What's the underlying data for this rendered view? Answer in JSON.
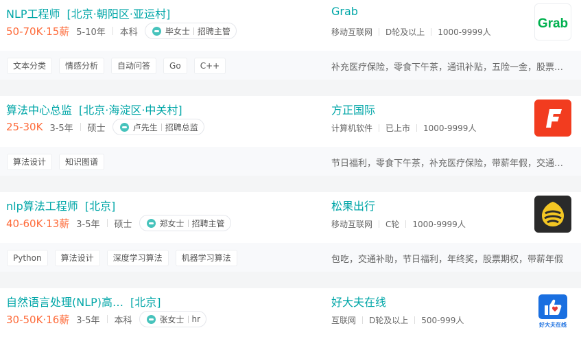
{
  "jobs": [
    {
      "title": "NLP工程师",
      "area": "[北京·朝阳区·亚运村]",
      "salary": "50-70K·15薪",
      "experience": "5-10年",
      "degree": "本科",
      "recruiter_name": "毕女士",
      "recruiter_title": "招聘主管",
      "company": "Grab",
      "industry": "移动互联网",
      "stage": "D轮及以上",
      "size": "1000-9999人",
      "logo_text": "Grab",
      "tags": [
        "文本分类",
        "情感分析",
        "自动问答",
        "Go",
        "C++"
      ],
      "welfare": "补充医疗保险，零食下午茶，通讯补贴，五险一金，股票期权"
    },
    {
      "title": "算法中心总监",
      "area": "[北京·海淀区·中关村]",
      "salary": "25-30K",
      "experience": "3-5年",
      "degree": "硕士",
      "recruiter_name": "卢先生",
      "recruiter_title": "招聘总监",
      "company": "方正国际",
      "industry": "计算机软件",
      "stage": "已上市",
      "size": "1000-9999人",
      "logo_text": "F",
      "tags": [
        "算法设计",
        "知识图谱"
      ],
      "welfare": "节日福利，零食下午茶，补充医疗保险，带薪年假，交通补助"
    },
    {
      "title": "nlp算法工程师",
      "area": "[北京]",
      "salary": "40-60K·13薪",
      "experience": "3-5年",
      "degree": "硕士",
      "recruiter_name": "郑女士",
      "recruiter_title": "招聘主管",
      "company": "松果出行",
      "industry": "移动互联网",
      "stage": "C轮",
      "size": "1000-9999人",
      "logo_text": "",
      "tags": [
        "Python",
        "算法设计",
        "深度学习算法",
        "机器学习算法"
      ],
      "welfare": "包吃，交通补助，节日福利，年终奖，股票期权，带薪年假"
    },
    {
      "title": "自然语言处理(NLP)高…",
      "area": "[北京]",
      "salary": "30-50K·16薪",
      "experience": "3-5年",
      "degree": "本科",
      "recruiter_name": "张女士",
      "recruiter_title": "hr",
      "company": "好大夫在线",
      "industry": "互联网",
      "stage": "D轮及以上",
      "size": "500-999人",
      "logo_text": "好大夫在线",
      "tags": [],
      "welfare": ""
    }
  ],
  "colors": {
    "accent": "#00a6a7",
    "salary": "#fe6b3a",
    "grab_green": "#00b14f",
    "founder_red": "#f23c1f",
    "songguo_bg": "#2a2a2a",
    "songguo_yellow": "#f3c623",
    "haodf_blue": "#1a6fe0"
  }
}
